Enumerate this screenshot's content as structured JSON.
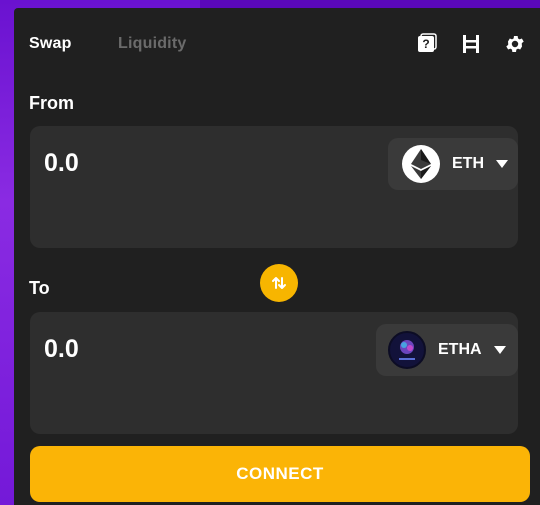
{
  "header": {
    "tabs": [
      {
        "label": "Swap",
        "active": true
      },
      {
        "label": "Liquidity",
        "active": false
      }
    ],
    "icons": [
      "help-icon",
      "route-icon",
      "settings-icon"
    ]
  },
  "from": {
    "label": "From",
    "amount": "0.0",
    "token": {
      "symbol": "ETH",
      "icon": "ethereum-logo-icon"
    }
  },
  "switch_icon": "swap-direction-icon",
  "to": {
    "label": "To",
    "amount": "0.0",
    "token": {
      "symbol": "ETHA",
      "icon": "etha-logo-icon"
    }
  },
  "connect": {
    "label": "CONNECT"
  },
  "colors": {
    "accent": "#fbb406",
    "card_bg": "#202020",
    "panel_bg": "#2e2e2e",
    "page_bg": "#7b1fd9",
    "inactive_tab": "#6b6b6b"
  }
}
